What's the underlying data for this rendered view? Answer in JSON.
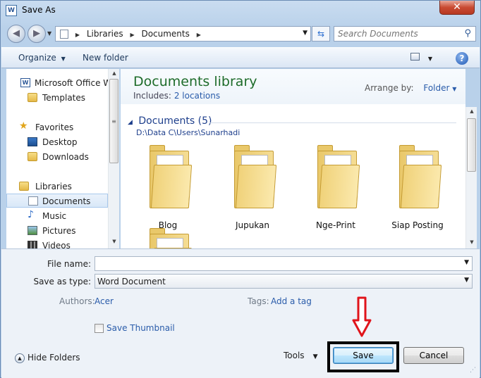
{
  "window": {
    "title": "Save As",
    "app_icon": "W"
  },
  "address": {
    "crumbs": [
      "Libraries",
      "Documents"
    ]
  },
  "search": {
    "placeholder": "Search Documents"
  },
  "toolbar": {
    "organize": "Organize",
    "new_folder": "New folder",
    "help": "?"
  },
  "nav": {
    "items": [
      {
        "label": "Microsoft Office Wo",
        "icon": "word-doc-icon"
      },
      {
        "label": "Templates",
        "icon": "folder-icon"
      },
      {
        "label": "Favorites",
        "icon": "star-icon"
      },
      {
        "label": "Desktop",
        "icon": "desktop-icon"
      },
      {
        "label": "Downloads",
        "icon": "folder-icon"
      },
      {
        "label": "Libraries",
        "icon": "libraries-icon"
      },
      {
        "label": "Documents",
        "icon": "documents-icon"
      },
      {
        "label": "Music",
        "icon": "music-icon"
      },
      {
        "label": "Pictures",
        "icon": "pictures-icon"
      },
      {
        "label": "Videos",
        "icon": "videos-icon"
      }
    ],
    "selected": "Documents"
  },
  "library": {
    "title": "Documents library",
    "includes_label": "Includes:",
    "includes_link": "2 locations",
    "arrange_label": "Arrange by:",
    "arrange_value": "Folder",
    "group_header": "Documents (5)",
    "group_path": "D:\\Data C\\Users\\Sunarhadi",
    "folders": [
      "Blog",
      "Jupukan",
      "Nge-Print",
      "Siap Posting"
    ]
  },
  "form": {
    "file_name_label": "File name:",
    "file_name_value": "",
    "save_type_label": "Save as type:",
    "save_type_value": "Word Document",
    "authors_label": "Authors:",
    "authors_value": "Acer",
    "tags_label": "Tags:",
    "tags_value": "Add a tag",
    "thumbnail_label": "Save Thumbnail"
  },
  "footer": {
    "hide_folders": "Hide Folders",
    "tools": "Tools",
    "save": "Save",
    "cancel": "Cancel"
  },
  "colors": {
    "library_title": "#1e6c2a",
    "link": "#2a5caa",
    "arrow": "#e0141b",
    "highlight": "#000000"
  }
}
